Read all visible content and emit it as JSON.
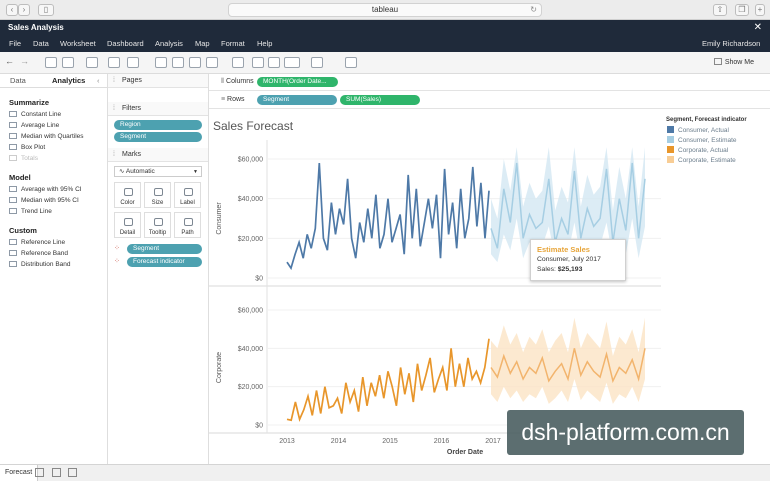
{
  "browser": {
    "url": "tableau"
  },
  "window": {
    "title": "Sales Analysis",
    "close_glyph": "✕"
  },
  "menu": {
    "items": [
      "File",
      "Data",
      "Worksheet",
      "Dashboard",
      "Analysis",
      "Map",
      "Format",
      "Help"
    ],
    "user": "Emily Richardson"
  },
  "toolbar": {
    "show_me": "Show Me"
  },
  "left_pane": {
    "tabs": [
      "Data",
      "Analytics"
    ],
    "summarize": {
      "title": "Summarize",
      "items": [
        "Constant Line",
        "Average Line",
        "Median with Quartiles",
        "Box Plot",
        "Totals"
      ]
    },
    "model": {
      "title": "Model",
      "items": [
        "Average with 95% CI",
        "Median with 95% CI",
        "Trend Line"
      ]
    },
    "custom": {
      "title": "Custom",
      "items": [
        "Reference Line",
        "Reference Band",
        "Distribution Band"
      ]
    }
  },
  "cards": {
    "pages": "Pages",
    "filters": {
      "title": "Filters",
      "pills": [
        "Region",
        "Segment"
      ]
    },
    "marks": {
      "title": "Marks",
      "type": "Automatic",
      "buttons": [
        "Color",
        "Size",
        "Label",
        "Detail",
        "Tooltip",
        "Path"
      ],
      "pills": [
        "Segment",
        "Forecast indicator"
      ]
    }
  },
  "shelves": {
    "columns": {
      "label": "Columns",
      "pill": "MONTH(Order Date..."
    },
    "rows": {
      "label": "Rows",
      "pills": [
        "Segment",
        "SUM(Sales)"
      ]
    }
  },
  "view": {
    "title": "Sales Forecast",
    "xlabel": "Order Date",
    "panes": [
      "Consumer",
      "Corporate"
    ]
  },
  "legend": {
    "title": "Segment, Forecast indicator",
    "entries": [
      {
        "label": "Consumer, Actual",
        "color": "#4e79a7"
      },
      {
        "label": "Consumer, Estimate",
        "color": "#a6cee3"
      },
      {
        "label": "Corporate, Actual",
        "color": "#e8962b"
      },
      {
        "label": "Corporate, Estimate",
        "color": "#f8cd95"
      }
    ]
  },
  "tooltip": {
    "title": "Estimate Sales",
    "line1": "Consumer, July 2017",
    "line2_label": "Sales:",
    "line2_value": "$25,193"
  },
  "bottom": {
    "sheet_tab": "Forecast"
  },
  "watermark": "dsh-platform.com.cn",
  "chart_data": {
    "type": "line",
    "x_ticks": [
      "2013",
      "2014",
      "2015",
      "2016",
      "2017"
    ],
    "xlabel": "Order Date",
    "panes": [
      {
        "name": "Consumer",
        "yticks": [
          "$60,000",
          "$40,000",
          "$20,000",
          "$0"
        ],
        "ylim": [
          0,
          70000
        ],
        "actual_color": "#4e79a7",
        "estimate_color": "#a6cee3",
        "band_color": "#d3e7f3",
        "actual": [
          8000,
          5000,
          12000,
          18000,
          10000,
          22000,
          15000,
          25000,
          58000,
          20000,
          14000,
          38000,
          22000,
          35000,
          27000,
          50000,
          20000,
          10000,
          28000,
          18000,
          35000,
          20000,
          42000,
          15000,
          22000,
          40000,
          18000,
          25000,
          32000,
          12000,
          52000,
          20000,
          45000,
          16000,
          28000,
          40000,
          25000,
          42000,
          10000,
          55000,
          22000,
          38000,
          15000,
          45000,
          20000,
          30000,
          56000,
          26000,
          48000,
          20000,
          44000
        ],
        "estimate": [
          25000,
          15000,
          45000,
          28000,
          58000,
          20000,
          32000,
          25000,
          28000,
          50000,
          18000,
          30000,
          22000,
          54000,
          20000,
          35000,
          26000,
          30000,
          55000,
          18000,
          40000,
          24000,
          58000,
          20000,
          50000
        ],
        "band_low": [
          12000,
          8000,
          22000,
          14000,
          30000,
          10000,
          18000,
          14000,
          16000,
          26000,
          10000,
          16000,
          12000,
          28000,
          10000,
          18000,
          14000,
          16000,
          28000,
          10000,
          20000,
          12000,
          30000,
          10000,
          26000
        ],
        "band_high": [
          40000,
          30000,
          60000,
          44000,
          70000,
          36000,
          48000,
          40000,
          44000,
          66000,
          34000,
          46000,
          38000,
          70000,
          36000,
          52000,
          42000,
          46000,
          70000,
          34000,
          56000,
          40000,
          70000,
          36000,
          66000
        ]
      },
      {
        "name": "Corporate",
        "yticks": [
          "$60,000",
          "$40,000",
          "$20,000",
          "$0"
        ],
        "ylim": [
          0,
          70000
        ],
        "actual_color": "#e8962b",
        "estimate_color": "#f2b46d",
        "band_color": "#fbe4c4",
        "actual": [
          3000,
          2500,
          12000,
          3000,
          8000,
          15000,
          5000,
          18000,
          6000,
          20000,
          9000,
          10000,
          14000,
          6000,
          22000,
          12000,
          18000,
          7000,
          25000,
          10000,
          22000,
          15000,
          26000,
          14000,
          28000,
          20000,
          10000,
          30000,
          16000,
          27000,
          12000,
          32000,
          18000,
          26000,
          35000,
          17000,
          24000,
          30000,
          18000,
          40000,
          20000,
          32000,
          20000,
          35000,
          24000,
          28000,
          22000,
          30000,
          45000
        ],
        "estimate": [
          30000,
          25000,
          36000,
          27000,
          33000,
          24000,
          30000,
          27000,
          35000,
          23000,
          28000,
          32000,
          24000,
          40000,
          26000,
          33000,
          28000,
          25000,
          37000,
          23000,
          30000,
          27000,
          34000,
          24000,
          40000
        ],
        "band_low": [
          16000,
          12000,
          20000,
          14000,
          18000,
          12000,
          16000,
          14000,
          20000,
          11000,
          14000,
          18000,
          12000,
          24000,
          13000,
          18000,
          15000,
          12000,
          22000,
          11000,
          16000,
          14000,
          20000,
          12000,
          24000
        ],
        "band_high": [
          44000,
          40000,
          52000,
          42000,
          48000,
          38000,
          46000,
          42000,
          50000,
          38000,
          44000,
          48000,
          38000,
          56000,
          40000,
          48000,
          44000,
          40000,
          54000,
          36000,
          46000,
          42000,
          50000,
          38000,
          56000
        ]
      }
    ]
  }
}
